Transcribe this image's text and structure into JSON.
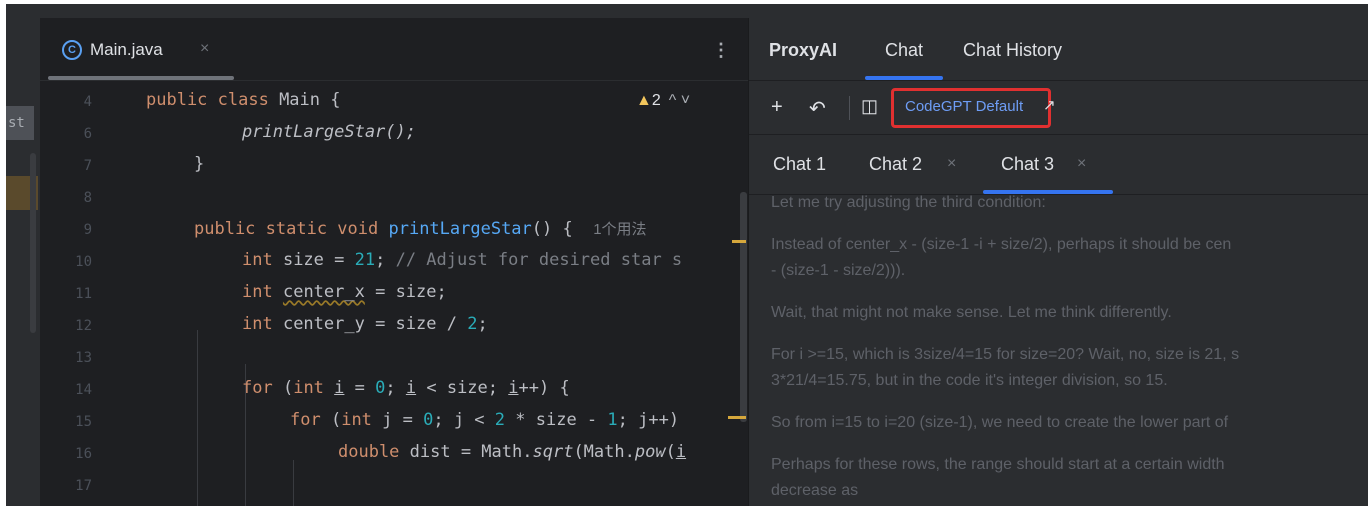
{
  "editor": {
    "tab_label": "Main.java",
    "tab_close": "×",
    "tab_menu": "⋮",
    "warning_count": "2",
    "warning_nav": "^ ˅",
    "gutter_tab_label": "st",
    "usage_hint": "1个用法",
    "lines": [
      {
        "num": "4",
        "text": "public class Main {"
      },
      {
        "num": "6",
        "text": "printLargeStar();"
      },
      {
        "num": "7",
        "text": "}"
      },
      {
        "num": "8",
        "text": ""
      },
      {
        "num": "9",
        "text": "public static void printLargeStar() {"
      },
      {
        "num": "10",
        "text": "int size = 21; // Adjust for desired star s"
      },
      {
        "num": "11",
        "text": "int center_x = size;"
      },
      {
        "num": "12",
        "text": "int center_y = size / 2;"
      },
      {
        "num": "13",
        "text": ""
      },
      {
        "num": "14",
        "text": "for (int i = 0; i < size; i++) {"
      },
      {
        "num": "15",
        "text": "for (int j = 0; j < 2 * size - 1; j++)"
      },
      {
        "num": "16",
        "text": "double dist = Math.sqrt(Math.pow(i"
      },
      {
        "num": "17",
        "text": ""
      }
    ]
  },
  "panel": {
    "tabs": [
      "ProxyAI",
      "Chat",
      "Chat History"
    ],
    "toolbar": {
      "add": "+",
      "undo": "↶",
      "layout": "◫",
      "model": "CodeGPT Default",
      "model_arrow": "↗"
    },
    "chat_tabs": [
      {
        "label": "Chat 1",
        "close": ""
      },
      {
        "label": "Chat 2",
        "close": "×"
      },
      {
        "label": "Chat 3",
        "close": "×"
      }
    ],
    "messages": [
      "Let me try adjusting the third condition:",
      "Instead of center_x - (size-1 -i + size/2), perhaps it should be cen",
      "- (size-1 - size/2))).",
      "Wait, that might not make sense. Let me think differently.",
      "For i >=15, which is 3size/4=15 for size=20? Wait, no, size is 21, s",
      "3*21/4=15.75, but in the code it's integer division, so 15.",
      "So from i=15 to i=20 (size-1), we need to create the lower part of",
      "Perhaps for these rows, the range should start at a certain width",
      "decrease as"
    ]
  },
  "colors": {
    "accent": "#3574f0",
    "highlight_border": "#e03030",
    "keyword": "#cf8e6d",
    "function": "#56a8f5",
    "number": "#2aacb8"
  }
}
